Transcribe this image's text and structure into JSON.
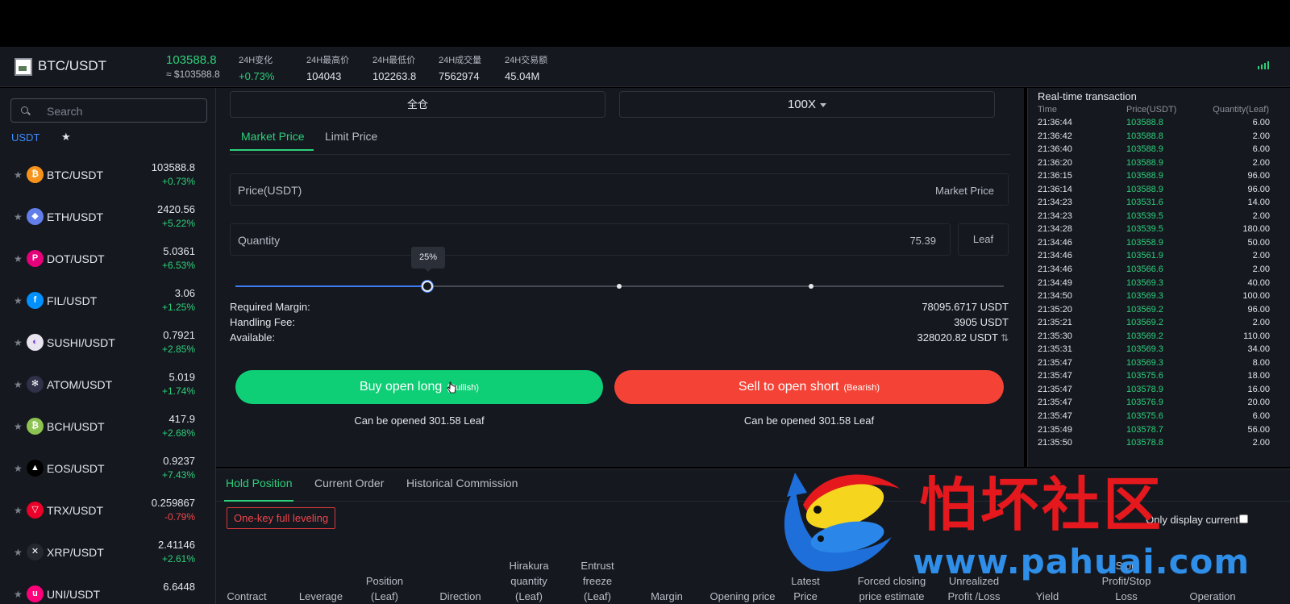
{
  "header": {
    "pair": "BTC/USDT",
    "price": "103588.8",
    "price_usd": "≈ $103588.8",
    "stats": [
      {
        "label": "24H变化",
        "value": "+0.73%",
        "green": true
      },
      {
        "label": "24H最高价",
        "value": "104043",
        "green": false
      },
      {
        "label": "24H最低价",
        "value": "102263.8",
        "green": false
      },
      {
        "label": "24H成交量",
        "value": "7562974",
        "green": false
      },
      {
        "label": "24H交易额",
        "value": "45.04M",
        "green": false
      }
    ]
  },
  "sidebar": {
    "search_placeholder": "Search",
    "tab_usdt": "USDT",
    "tab_fav": "★",
    "coins": [
      {
        "name": "BTC/USDT",
        "price": "103588.8",
        "change": "+0.73%",
        "up": true,
        "color": "#f7931a",
        "glyph": "₿"
      },
      {
        "name": "ETH/USDT",
        "price": "2420.56",
        "change": "+5.22%",
        "up": true,
        "color": "#627eea",
        "glyph": "◆"
      },
      {
        "name": "DOT/USDT",
        "price": "5.0361",
        "change": "+6.53%",
        "up": true,
        "color": "#e6007a",
        "glyph": "P"
      },
      {
        "name": "FIL/USDT",
        "price": "3.06",
        "change": "+1.25%",
        "up": true,
        "color": "#0090ff",
        "glyph": "f"
      },
      {
        "name": "SUSHI/USDT",
        "price": "0.7921",
        "change": "+2.85%",
        "up": true,
        "color": "#e8e4f0",
        "glyph": "◐"
      },
      {
        "name": "ATOM/USDT",
        "price": "5.019",
        "change": "+1.74%",
        "up": true,
        "color": "#2e3148",
        "glyph": "✻"
      },
      {
        "name": "BCH/USDT",
        "price": "417.9",
        "change": "+2.68%",
        "up": true,
        "color": "#8dc351",
        "glyph": "₿"
      },
      {
        "name": "EOS/USDT",
        "price": "0.9237",
        "change": "+7.43%",
        "up": true,
        "color": "#000000",
        "glyph": "▲"
      },
      {
        "name": "TRX/USDT",
        "price": "0.259867",
        "change": "-0.79%",
        "up": false,
        "color": "#eb0029",
        "glyph": "▽"
      },
      {
        "name": "XRP/USDT",
        "price": "2.41146",
        "change": "+2.61%",
        "up": true,
        "color": "#23292f",
        "glyph": "✕"
      },
      {
        "name": "UNI/USDT",
        "price": "6.6448",
        "change": "",
        "up": true,
        "color": "#ff007a",
        "glyph": "u"
      }
    ]
  },
  "trade": {
    "margin_mode": "全仓",
    "leverage": "100X",
    "tabs": [
      "Market Price",
      "Limit Price"
    ],
    "price_label": "Price(USDT)",
    "price_value": "Market Price",
    "quantity_label": "Quantity",
    "quantity_value": "75.39",
    "quantity_unit": "Leaf",
    "slider_percent": "25%",
    "slider_fraction": 0.25,
    "required_margin_label": "Required Margin:",
    "required_margin": "78095.6717 USDT",
    "handling_fee_label": "Handling Fee:",
    "handling_fee": "3905 USDT",
    "available_label": "Available:",
    "available": "328020.82 USDT",
    "buy_label": "Buy open long",
    "buy_sub": "(Bullish)",
    "sell_label": "Sell to open short",
    "sell_sub": "(Bearish)",
    "buy_can_open": "Can be opened 301.58 Leaf",
    "sell_can_open": "Can be opened 301.58 Leaf"
  },
  "realtime": {
    "title": "Real-time transaction",
    "col_time": "Time",
    "col_price": "Price(USDT)",
    "col_qty": "Quantity(Leaf)",
    "rows": [
      [
        "21:36:44",
        "103588.8",
        "6.00"
      ],
      [
        "21:36:42",
        "103588.8",
        "2.00"
      ],
      [
        "21:36:40",
        "103588.9",
        "6.00"
      ],
      [
        "21:36:20",
        "103588.9",
        "2.00"
      ],
      [
        "21:36:15",
        "103588.9",
        "96.00"
      ],
      [
        "21:36:14",
        "103588.9",
        "96.00"
      ],
      [
        "21:34:23",
        "103531.6",
        "14.00"
      ],
      [
        "21:34:23",
        "103539.5",
        "2.00"
      ],
      [
        "21:34:28",
        "103539.5",
        "180.00"
      ],
      [
        "21:34:46",
        "103558.9",
        "50.00"
      ],
      [
        "21:34:46",
        "103561.9",
        "2.00"
      ],
      [
        "21:34:46",
        "103566.6",
        "2.00"
      ],
      [
        "21:34:49",
        "103569.3",
        "40.00"
      ],
      [
        "21:34:50",
        "103569.3",
        "100.00"
      ],
      [
        "21:35:20",
        "103569.2",
        "96.00"
      ],
      [
        "21:35:21",
        "103569.2",
        "2.00"
      ],
      [
        "21:35:30",
        "103569.2",
        "110.00"
      ],
      [
        "21:35:31",
        "103569.3",
        "34.00"
      ],
      [
        "21:35:47",
        "103569.3",
        "8.00"
      ],
      [
        "21:35:47",
        "103575.6",
        "18.00"
      ],
      [
        "21:35:47",
        "103578.9",
        "16.00"
      ],
      [
        "21:35:47",
        "103576.9",
        "20.00"
      ],
      [
        "21:35:47",
        "103575.6",
        "6.00"
      ],
      [
        "21:35:49",
        "103578.7",
        "56.00"
      ],
      [
        "21:35:50",
        "103578.8",
        "2.00"
      ]
    ]
  },
  "positions": {
    "tabs": [
      "Hold Position",
      "Current Order",
      "Historical Commission"
    ],
    "one_key": "One-key full leveling",
    "only_display": "Only display current",
    "columns": [
      "Contract",
      "Leverage",
      "Position (Leaf)",
      "Direction",
      "Hirakura quantity (Leaf)",
      "Entrust freeze (Leaf)",
      "Margin",
      "Opening price",
      "Latest Price",
      "Forced closing price estimate",
      "Unrealized Profit /Loss",
      "Yield",
      "Stop Profit/Stop Loss",
      "Operation"
    ]
  },
  "watermark": {
    "text": "怕坏社区",
    "url": "www.pahuai.com"
  }
}
